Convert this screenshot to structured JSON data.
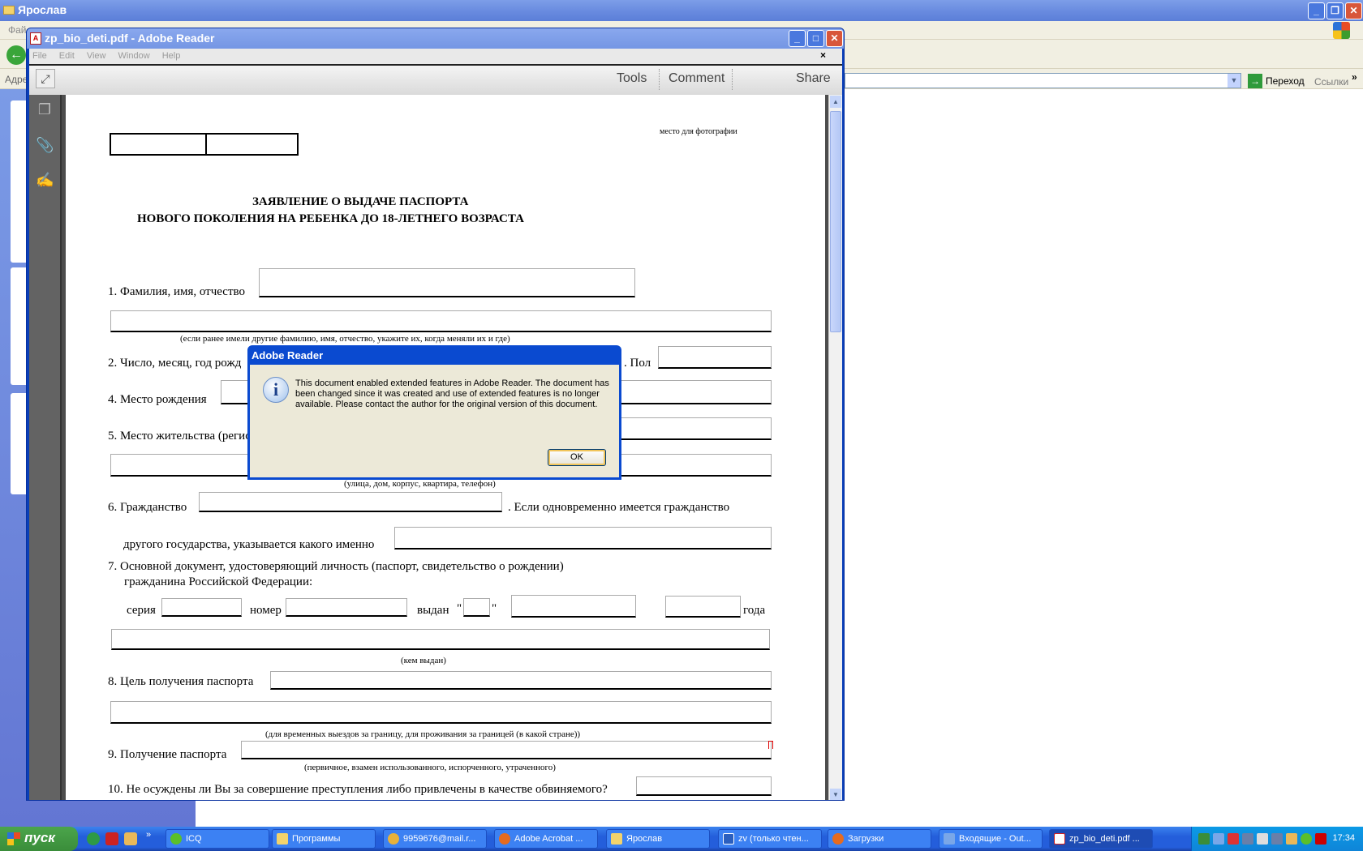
{
  "explorer": {
    "title": "Ярослав",
    "menu_partial": "Фай",
    "address_label": "Адре",
    "go_label": "Переход",
    "links_label": "Ссылки",
    "more": "»"
  },
  "reader": {
    "title": "zp_bio_deti.pdf - Adobe Reader",
    "menu": [
      "File",
      "Edit",
      "View",
      "Window",
      "Help"
    ],
    "close_doc": "×",
    "toolbar": {
      "tools": "Tools",
      "comment": "Comment",
      "share": "Share"
    }
  },
  "document": {
    "photo_label": "место для фотографии",
    "title1": "ЗАЯВЛЕНИЕ О ВЫДАЧЕ ПАСПОРТА",
    "title2": "НОВОГО ПОКОЛЕНИЯ НА РЕБЕНКА ДО 18-ЛЕТНЕГО ВОЗРАСТА",
    "f1": "1. Фамилия, имя, отчество",
    "f1_caption": "(если ранее имели другие фамилию, имя, отчество, укажите их, когда меняли их и где)",
    "f2": "2. Число, месяц, год рожд",
    "f3_sex": ". Пол",
    "f4": "4. Место рождения",
    "f5": "5. Место жительства (регистрации)",
    "f5_caption": "(улица, дом, корпус, квартира, телефон)",
    "f6": "6. Гражданство",
    "f6_cont": ". Если одновременно имеется гражданство",
    "f6_line2": "другого государства, указывается какого именно",
    "f7_line1": "7. Основной документ, удостоверяющий личность (паспорт, свидетельство о рождении)",
    "f7_line2": "гражданина Российской Федерации:",
    "series": "серия",
    "number": "номер",
    "issued": "выдан",
    "quote": "\"",
    "year": "года",
    "f7_caption": "(кем выдан)",
    "f8": "8. Цель получения паспорта",
    "f8_caption": "(для временных выездов за границу, для проживания за границей (в какой стране))",
    "f9": "9. Получение паспорта",
    "f9_caption": "(первичное, взамен использованного, испорченного, утраченного)",
    "f10": "10. Не осуждены ли Вы за совершение преступления либо привлечены в качестве обвиняемого?"
  },
  "dialog": {
    "title": "Adobe Reader",
    "message": "This document enabled extended features in Adobe Reader. The document has been changed since it was created and use of extended features is no longer available. Please contact the author for the original version of this document.",
    "ok": "OK"
  },
  "taskbar": {
    "start": "пуск",
    "tasks": [
      {
        "label": "ICQ",
        "color": "#5bbf2a"
      },
      {
        "label": "Программы",
        "color": "#f3d36c"
      },
      {
        "label": "9959676@mail.r...",
        "color": "#e8b13a"
      },
      {
        "label": "Adobe Acrobat ...",
        "color": "#e66b1f"
      },
      {
        "label": "Ярослав",
        "color": "#f3d36c"
      },
      {
        "label": "zv (только чтен...",
        "color": "#2b5fbf"
      },
      {
        "label": "Загрузки",
        "color": "#e66b1f"
      },
      {
        "label": "Входящие - Out...",
        "color": "#7aa7e8"
      },
      {
        "label": "zp_bio_deti.pdf ...",
        "color": "#d02020"
      }
    ],
    "clock": "17:34"
  }
}
